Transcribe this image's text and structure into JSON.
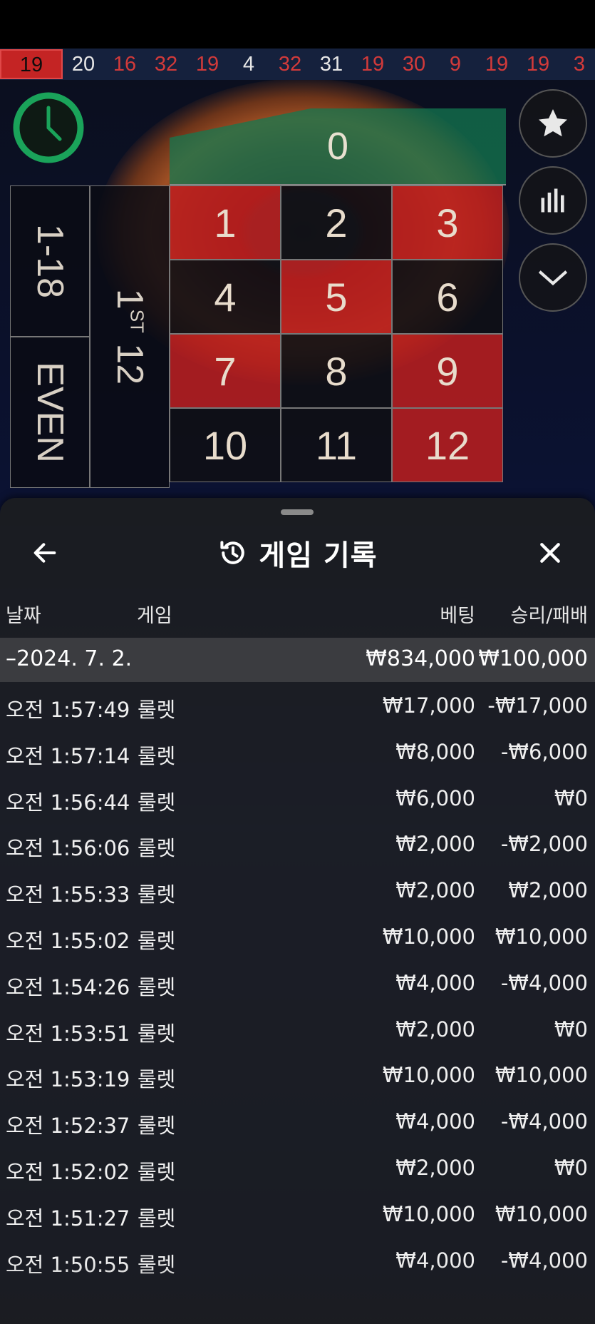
{
  "history": [
    "19",
    "20",
    "16",
    "32",
    "19",
    "4",
    "32",
    "31",
    "19",
    "30",
    "9",
    "19",
    "19",
    "3"
  ],
  "history_colors": [
    "red",
    "black",
    "red",
    "red",
    "red",
    "black",
    "red",
    "black",
    "red",
    "red",
    "red",
    "red",
    "red",
    "red"
  ],
  "board": {
    "zero": "0",
    "rows": [
      [
        "1",
        "2",
        "3"
      ],
      [
        "4",
        "5",
        "6"
      ],
      [
        "7",
        "8",
        "9"
      ],
      [
        "10",
        "11",
        "12"
      ]
    ],
    "row_colors": [
      [
        "red",
        "black",
        "red"
      ],
      [
        "black",
        "red",
        "black"
      ],
      [
        "red",
        "black",
        "red"
      ],
      [
        "black",
        "black",
        "red"
      ]
    ],
    "low": "1-18",
    "even": "EVEN",
    "dozen_num": "1",
    "dozen_suffix": "ST",
    "dozen_12": "12"
  },
  "side_buttons": [
    "star-icon",
    "stats-icon",
    "chevron-down-icon"
  ],
  "sheet": {
    "title": "게임 기록",
    "columns": {
      "date": "날짜",
      "game": "게임",
      "bet": "베팅",
      "result": "승리/패배"
    },
    "date_group": {
      "date": "–2024. 7. 2.",
      "bet": "₩834,000",
      "result": "₩100,000"
    },
    "rows": [
      {
        "time": "오전 1:57:49",
        "game": "룰렛",
        "bet": "₩17,000",
        "result": "-₩17,000"
      },
      {
        "time": "오전 1:57:14",
        "game": "룰렛",
        "bet": "₩8,000",
        "result": "-₩6,000"
      },
      {
        "time": "오전 1:56:44",
        "game": "룰렛",
        "bet": "₩6,000",
        "result": "₩0"
      },
      {
        "time": "오전 1:56:06",
        "game": "룰렛",
        "bet": "₩2,000",
        "result": "-₩2,000"
      },
      {
        "time": "오전 1:55:33",
        "game": "룰렛",
        "bet": "₩2,000",
        "result": "₩2,000"
      },
      {
        "time": "오전 1:55:02",
        "game": "룰렛",
        "bet": "₩10,000",
        "result": "₩10,000"
      },
      {
        "time": "오전 1:54:26",
        "game": "룰렛",
        "bet": "₩4,000",
        "result": "-₩4,000"
      },
      {
        "time": "오전 1:53:51",
        "game": "룰렛",
        "bet": "₩2,000",
        "result": "₩0"
      },
      {
        "time": "오전 1:53:19",
        "game": "룰렛",
        "bet": "₩10,000",
        "result": "₩10,000"
      },
      {
        "time": "오전 1:52:37",
        "game": "룰렛",
        "bet": "₩4,000",
        "result": "-₩4,000"
      },
      {
        "time": "오전 1:52:02",
        "game": "룰렛",
        "bet": "₩2,000",
        "result": "₩0"
      },
      {
        "time": "오전 1:51:27",
        "game": "룰렛",
        "bet": "₩10,000",
        "result": "₩10,000"
      },
      {
        "time": "오전 1:50:55",
        "game": "룰렛",
        "bet": "₩4,000",
        "result": "-₩4,000"
      }
    ]
  },
  "colors": {
    "red": "#c42424",
    "black": "#111114",
    "green": "#1aa35a",
    "sheet_bg": "#1c1d20",
    "date_row_bg": "#3b3c40"
  }
}
